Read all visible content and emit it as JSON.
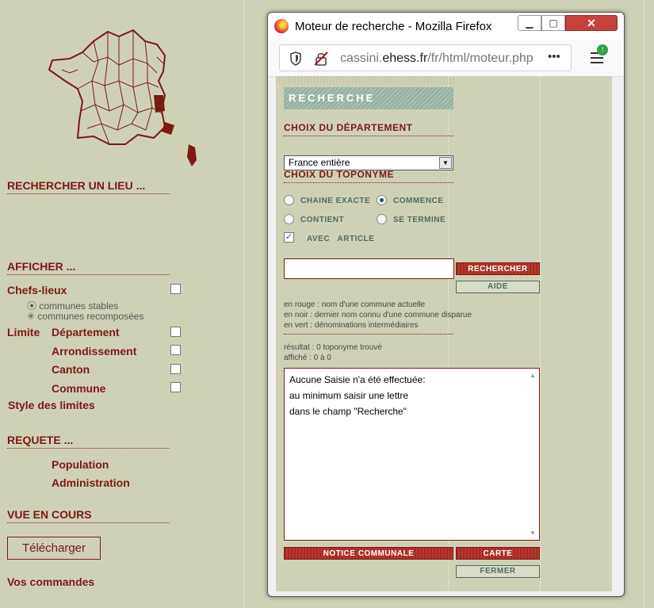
{
  "left": {
    "rechercher_lieu": "RECHERCHER UN LIEU ...",
    "afficher": "AFFICHER ...",
    "chefs_lieux": "Chefs-lieux",
    "communes_stables": "communes stables",
    "communes_recomposees": "communes recomposées",
    "limite": "Limite",
    "departement": "Département",
    "arrondissement": "Arrondissement",
    "canton": "Canton",
    "commune": "Commune",
    "style_limites": "Style des limites",
    "requete": "REQUETE ...",
    "population": "Population",
    "administration": "Administration",
    "vue_en_cours": "VUE EN COURS",
    "telecharger": "Télécharger",
    "vos_commandes": "Vos commandes"
  },
  "window": {
    "title": "Moteur de recherche - Mozilla Firefox",
    "url_prefix": "cassini.",
    "url_domain": "ehess.fr",
    "url_path": "/fr/html/moteur.php",
    "more": "•••"
  },
  "search": {
    "header": "RECHERCHE",
    "choix_departement": "CHOIX DU DÉPARTEMENT",
    "departement_value": "France entière",
    "choix_toponyme": "CHOIX DU TOPONYME",
    "chaine_exacte": "CHAINE EXACTE",
    "commence": "COMMENCE",
    "contient": "CONTIENT",
    "se_termine": "SE TERMINE",
    "avec_article": "AVEC   ARTICLE",
    "rechercher_btn": "RECHERCHER",
    "aide_btn": "AIDE",
    "legend_rouge": "en rouge : nom d'une commune actuelle",
    "legend_noir": "en noir : dernier nom connu d'une commune disparue",
    "legend_vert": "en vert : dénominations intermédiaires",
    "resultat": "résultat : 0 toponyme trouvé",
    "affiche": "affiché : 0 à 0",
    "result_line1": "Aucune Saisie n'a été effectuée:",
    "result_line2": "au minimum saisir une lettre",
    "result_line3": "dans le champ \"Recherche\"",
    "notice_btn": "NOTICE COMMUNALE",
    "carte_btn": "CARTE",
    "fermer_btn": "FERMER"
  },
  "colors": {
    "accent": "#7a1a12",
    "background": "#cfd1b7",
    "green": "#4d6b5e"
  }
}
